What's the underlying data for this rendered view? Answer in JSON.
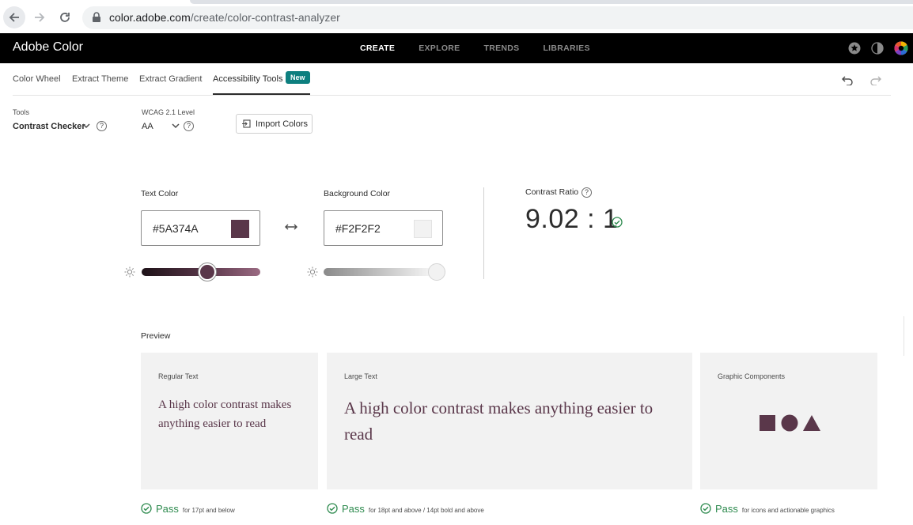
{
  "browser": {
    "url_domain": "color.adobe.com",
    "url_path": "/create/color-contrast-analyzer"
  },
  "header": {
    "brand": "Adobe Color",
    "nav": [
      {
        "label": "CREATE",
        "active": true
      },
      {
        "label": "EXPLORE",
        "active": false
      },
      {
        "label": "TRENDS",
        "active": false
      },
      {
        "label": "LIBRARIES",
        "active": false
      }
    ]
  },
  "subnav": {
    "tabs": [
      "Color Wheel",
      "Extract Theme",
      "Extract Gradient",
      "Accessibility Tools"
    ],
    "active_tab": "Accessibility Tools",
    "badge": "New"
  },
  "tools": {
    "tools_label": "Tools",
    "tools_value": "Contrast Checker",
    "wcag_label": "WCAG 2.1 Level",
    "wcag_value": "AA",
    "help": "?",
    "import_label": "Import Colors"
  },
  "text_color": {
    "label": "Text Color",
    "hex": "#5A374A",
    "swatch": "#5a374a",
    "brightness": 0.55
  },
  "background_color": {
    "label": "Background Color",
    "hex": "#F2F2F2",
    "swatch": "#f2f2f2",
    "brightness": 0.95
  },
  "contrast": {
    "label": "Contrast Ratio",
    "value": "9.02 : 1"
  },
  "preview": {
    "title": "Preview",
    "cards": [
      {
        "title": "Regular Text",
        "sample": "A high color contrast makes anything easier to read",
        "result": "Pass",
        "note": "for 17pt and below"
      },
      {
        "title": "Large Text",
        "sample": "A high color contrast makes anything easier to read",
        "result": "Pass",
        "note": "for 18pt and above / 14pt bold and above"
      },
      {
        "title": "Graphic Components",
        "sample": "",
        "result": "Pass",
        "note": "for icons and actionable graphics"
      }
    ]
  },
  "colors": {
    "accent": "#0d7f7f",
    "pass": "#2d8a4e",
    "text_sample": "#5a374a"
  }
}
